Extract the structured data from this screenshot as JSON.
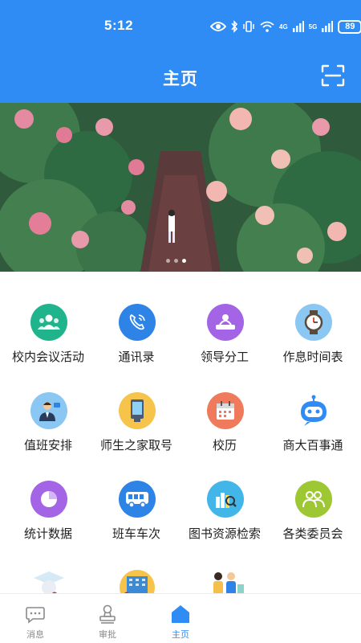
{
  "status_bar": {
    "time": "5:12",
    "network_label": "4G",
    "network_label_2": "5G",
    "battery": "89"
  },
  "header": {
    "title": "主页",
    "scan_icon": "scan-icon",
    "background_color": "#2f8cf4"
  },
  "banner": {
    "slide_count": 3,
    "active_slide": 1
  },
  "apps": [
    {
      "label": "校内会议活动",
      "icon": "meeting-people-icon",
      "color": "#20b48c"
    },
    {
      "label": "通讯录",
      "icon": "phone-contacts-icon",
      "color": "#2d84e6"
    },
    {
      "label": "领导分工",
      "icon": "leader-division-icon",
      "color": "#a464e6"
    },
    {
      "label": "作息时间表",
      "icon": "watch-icon",
      "color": "#8ac7f2"
    },
    {
      "label": "值班安排",
      "icon": "duty-person-icon",
      "color": "#8ac7f2"
    },
    {
      "label": "师生之家取号",
      "icon": "kiosk-icon",
      "color": "#f6c34b"
    },
    {
      "label": "校历",
      "icon": "calendar-icon",
      "color": "#f07b5c"
    },
    {
      "label": "商大百事通",
      "icon": "robot-icon",
      "color": "#2f8cf4"
    },
    {
      "label": "统计数据",
      "icon": "pie-chart-icon",
      "color": "#a464e6"
    },
    {
      "label": "班车车次",
      "icon": "bus-icon",
      "color": "#2d84e6"
    },
    {
      "label": "图书资源检索",
      "icon": "book-search-icon",
      "color": "#42b6e8"
    },
    {
      "label": "各类委员会",
      "icon": "committee-icon",
      "color": "#9dc733"
    }
  ],
  "partial_row_icons": [
    "graduate-icon",
    "building-icon",
    "people-group-icon"
  ],
  "tabbar": {
    "tabs": [
      {
        "label": "消息",
        "icon": "message-icon",
        "badge": false
      },
      {
        "label": "审批",
        "icon": "approval-stamp-icon",
        "badge": false
      },
      {
        "label": "主页",
        "icon": "home-icon",
        "active": true
      }
    ]
  }
}
